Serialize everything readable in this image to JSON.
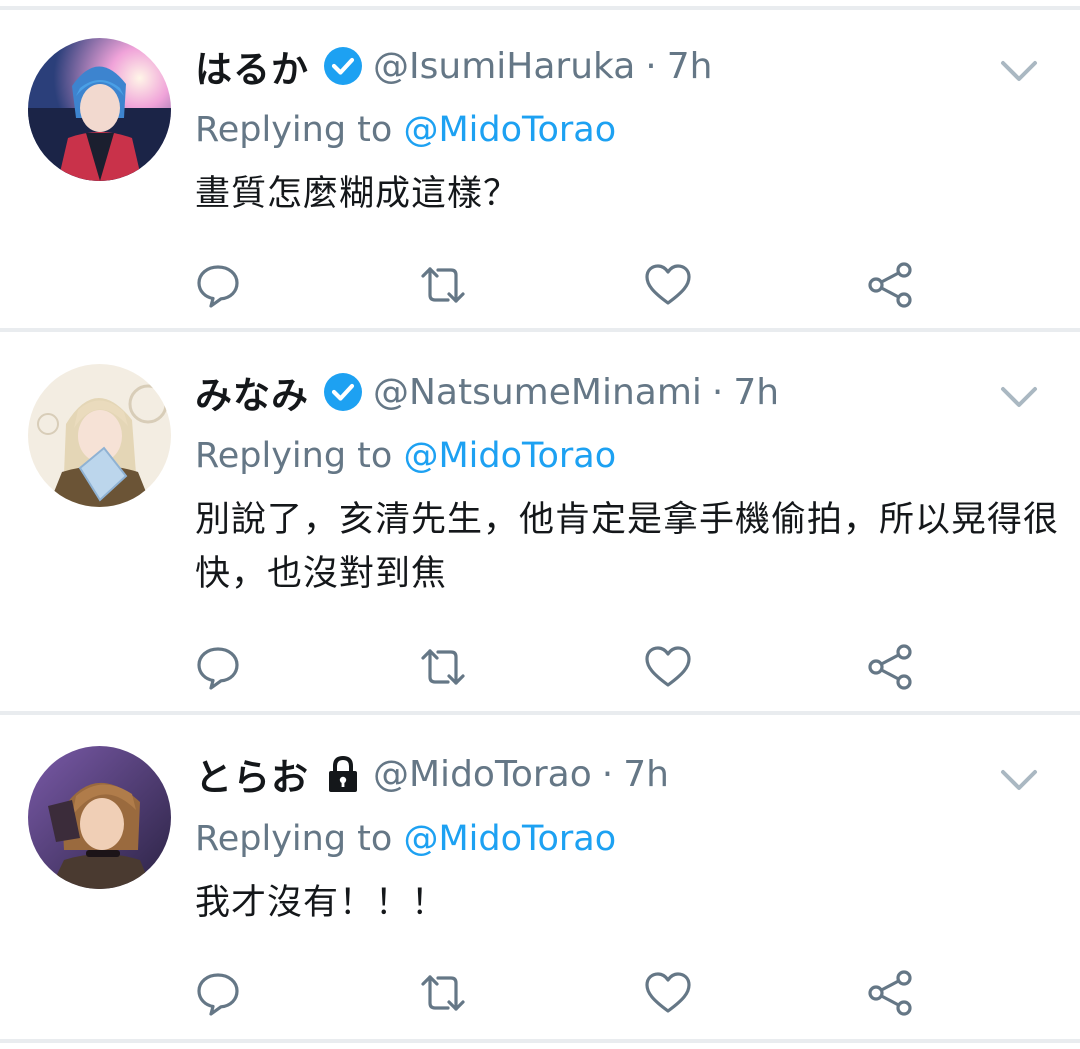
{
  "tweets": [
    {
      "name": "はるか",
      "badge": "verified-icon",
      "handle": "@IsumiHaruka",
      "separator": "·",
      "time": "7h",
      "replying_prefix": "Replying to ",
      "replying_to": "@MidoTorao",
      "text": "畫質怎麼糊成這樣？"
    },
    {
      "name": "みなみ",
      "badge": "verified-icon",
      "handle": "@NatsumeMinami",
      "separator": "·",
      "time": "7h",
      "replying_prefix": "Replying to ",
      "replying_to": "@MidoTorao",
      "text": "別說了，亥清先生，他肯定是拿手機偷拍，所以晃得很快，也沒對到焦"
    },
    {
      "name": "とらお",
      "badge": "lock-icon",
      "handle": "@MidoTorao",
      "separator": "·",
      "time": "7h",
      "replying_prefix": "Replying to ",
      "replying_to": "@MidoTorao",
      "text": "我才沒有！！！"
    }
  ],
  "actions": [
    "reply-icon",
    "retweet-icon",
    "like-icon",
    "share-icon"
  ],
  "colors": {
    "link": "#1da1f2",
    "muted": "#657786",
    "text": "#14171a",
    "separator": "#e9ecef",
    "verified": "#1da1f2"
  }
}
